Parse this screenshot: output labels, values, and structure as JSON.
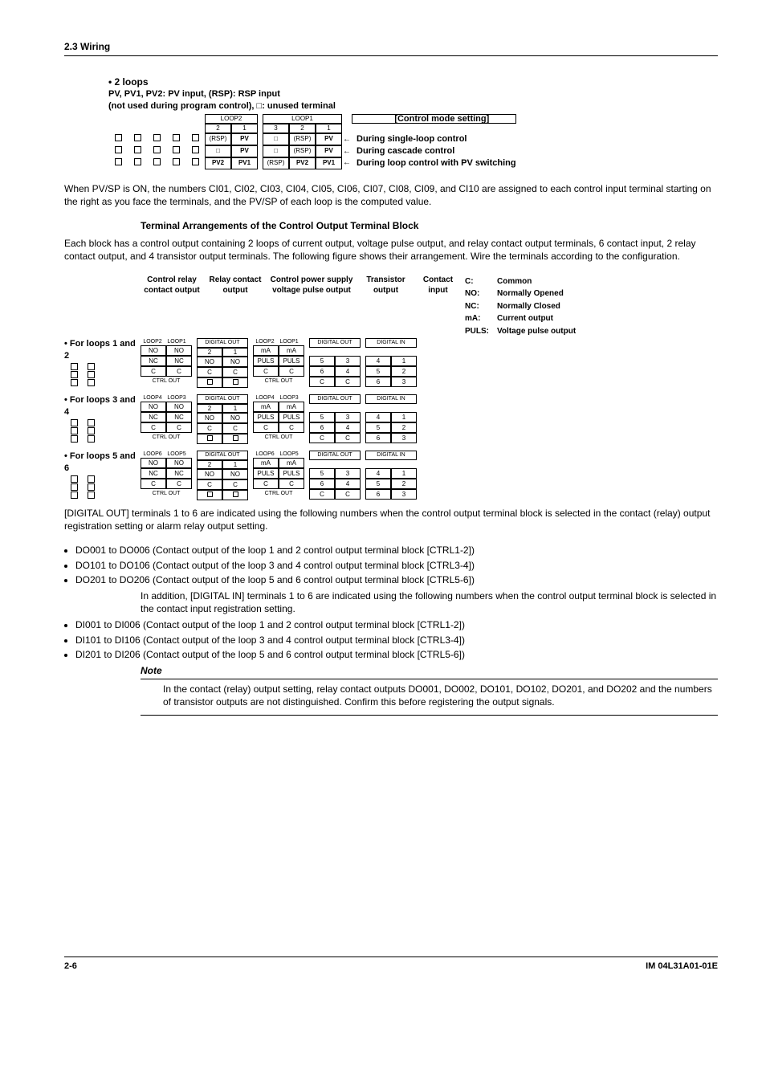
{
  "header": "2.3  Wiring",
  "two_loops": {
    "title": "• 2 loops",
    "sub1": "PV, PV1, PV2: PV input, (RSP): RSP input",
    "sub2": "(not used during program control), □: unused terminal",
    "head_loop2": "LOOP2",
    "head_loop1": "LOOP1",
    "subhead": [
      "2",
      "1",
      "3",
      "2",
      "1"
    ],
    "rows": [
      {
        "cells": [
          "(RSP)",
          "PV",
          "□",
          "(RSP)",
          "PV"
        ],
        "desc": "During single-loop control"
      },
      {
        "cells": [
          "□",
          "PV",
          "□",
          "(RSP)",
          "PV"
        ],
        "desc": "During cascade control"
      },
      {
        "cells": [
          "PV2",
          "PV1",
          "(RSP)",
          "PV2",
          "PV1"
        ],
        "desc": "During loop control with PV switching"
      }
    ],
    "mode_label": "[Control mode setting]"
  },
  "pv_para": "When PV/SP is ON, the numbers CI01, CI02, CI03, CI04, CI05, CI06, CI07, CI08, CI09, and CI10 are assigned to each control input terminal starting on the right as you face the terminals, and the PV/SP of each loop is the computed value.",
  "term_title": "Terminal Arrangements of the Control Output Terminal Block",
  "term_para": "Each block has a control output containing 2 loops of current output, voltage pulse output, and relay contact output terminals, 6 contact input, 2 relay contact output, and 4 transistor output terminals.  The following figure shows their arrangement.  Wire the terminals according to the configuration.",
  "col_headings": {
    "relay_contact_out": "Control relay contact output",
    "relay_contact": "Relay contact output",
    "volt_pulse": "Control power supply voltage pulse output",
    "trans_out": "Transistor output",
    "contact_in": "Contact input"
  },
  "abbrev": {
    "C": "Common",
    "NO": "Normally Opened",
    "NC": "Normally Closed",
    "mA": "Current output",
    "PULS": "Voltage pulse output"
  },
  "block_groups": [
    {
      "title": "• For loops 1 and 2",
      "loops": [
        "LOOP2",
        "LOOP1"
      ],
      "loopsR": [
        "LOOP2",
        "LOOP1"
      ]
    },
    {
      "title": "• For loops 3 and 4",
      "loops": [
        "LOOP4",
        "LOOP3"
      ],
      "loopsR": [
        "LOOP4",
        "LOOP3"
      ]
    },
    {
      "title": "• For loops 5 and 6",
      "loops": [
        "LOOP6",
        "LOOP5"
      ],
      "loopsR": [
        "LOOP6",
        "LOOP5"
      ]
    }
  ],
  "block_rows": {
    "r1": [
      "NO",
      "NO",
      "NO",
      "NO",
      "mA",
      "mA",
      "5",
      "3",
      "4",
      "1"
    ],
    "r2": [
      "NC",
      "NC",
      "C",
      "C",
      "PULS",
      "PULS",
      "6",
      "4",
      "5",
      "2"
    ],
    "r3": [
      "C",
      "C",
      "□",
      "□",
      "C",
      "C",
      "C",
      "C",
      "6",
      "3"
    ]
  },
  "digital_out": "DIGITAL OUT",
  "digital_in": "DIGITAL IN",
  "ctrl_out": "CTRL OUT",
  "after_diag_1": "[DIGITAL OUT] terminals 1 to 6 are indicated using the following numbers when the control output terminal block is selected in the contact (relay) output registration setting or alarm relay output setting.",
  "bullets_do": [
    "DO001 to DO006 (Contact output of the loop 1 and 2 control output terminal block [CTRL1-2])",
    "DO101 to DO106 (Contact output of the loop 3 and 4 control output terminal block [CTRL3-4])",
    "DO201 to DO206 (Contact output of the loop 5 and 6 control output terminal block [CTRL5-6])"
  ],
  "after_diag_2": "In addition, [DIGITAL IN] terminals 1 to 6 are indicated using the following numbers when the control output terminal block is selected in the contact input registration setting.",
  "bullets_di": [
    "DI001 to DI006 (Contact output of the loop 1 and 2 control output terminal block [CTRL1-2])",
    "DI101 to DI106 (Contact output of the loop 3 and 4 control output terminal block [CTRL3-4])",
    "DI201 to DI206 (Contact output of the loop 5 and 6 control output terminal block [CTRL5-6])"
  ],
  "note_label": "Note",
  "note_body": "In the contact (relay) output setting, relay contact outputs DO001, DO002, DO101, DO102, DO201, and DO202 and the numbers of transistor outputs are not distinguished.  Confirm this before registering the output signals.",
  "footer_left": "2-6",
  "footer_right": "IM 04L31A01-01E"
}
